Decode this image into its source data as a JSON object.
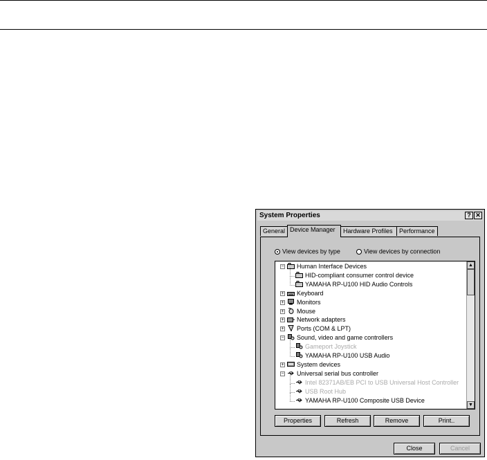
{
  "dialog": {
    "title": "System Properties",
    "help_label": "?",
    "close_label": "✕"
  },
  "tabs": [
    {
      "label": "General"
    },
    {
      "label": "Device Manager"
    },
    {
      "label": "Hardware Profiles"
    },
    {
      "label": "Performance"
    }
  ],
  "view_options": {
    "by_type": "View devices by type",
    "by_connection": "View devices by connection",
    "selected": "by_type"
  },
  "tree": {
    "items": [
      {
        "label": "Human Interface Devices",
        "level": 0,
        "expander": "−",
        "icon": "hid-icon"
      },
      {
        "label": "HID-compliant consumer control device",
        "level": 1,
        "icon": "hid-icon"
      },
      {
        "label": "YAMAHA RP-U100 HID Audio Controls",
        "level": 1,
        "icon": "hid-icon"
      },
      {
        "label": "Keyboard",
        "level": 0,
        "expander": "+",
        "icon": "keyboard-icon"
      },
      {
        "label": "Monitors",
        "level": 0,
        "expander": "+",
        "icon": "monitor-icon"
      },
      {
        "label": "Mouse",
        "level": 0,
        "expander": "+",
        "icon": "mouse-icon"
      },
      {
        "label": "Network adapters",
        "level": 0,
        "expander": "+",
        "icon": "network-icon"
      },
      {
        "label": "Ports (COM & LPT)",
        "level": 0,
        "expander": "+",
        "icon": "port-icon"
      },
      {
        "label": "Sound, video and game controllers",
        "level": 0,
        "expander": "−",
        "icon": "sound-icon"
      },
      {
        "label": "Gameport Joystick",
        "level": 1,
        "icon": "sound-icon",
        "dim": true
      },
      {
        "label": "YAMAHA RP-U100 USB Audio",
        "level": 1,
        "icon": "sound-icon"
      },
      {
        "label": "System devices",
        "level": 0,
        "expander": "+",
        "icon": "system-icon"
      },
      {
        "label": "Universal serial bus controller",
        "level": 0,
        "expander": "−",
        "icon": "usb-icon"
      },
      {
        "label": "Intel 82371AB/EB PCI to USB Universal Host Controller",
        "level": 1,
        "icon": "usb-icon",
        "dim": true
      },
      {
        "label": "USB Root Hub",
        "level": 1,
        "icon": "usb-icon",
        "dim": true
      },
      {
        "label": "YAMAHA RP-U100 Composite USB Device",
        "level": 1,
        "icon": "usb-icon"
      }
    ]
  },
  "buttons": {
    "properties": "Properties",
    "refresh": "Refresh",
    "remove": "Remove",
    "print": "Print..",
    "close": "Close",
    "cancel": "Cancel"
  },
  "scrollbar": {
    "up": "▲",
    "down": "▼"
  }
}
